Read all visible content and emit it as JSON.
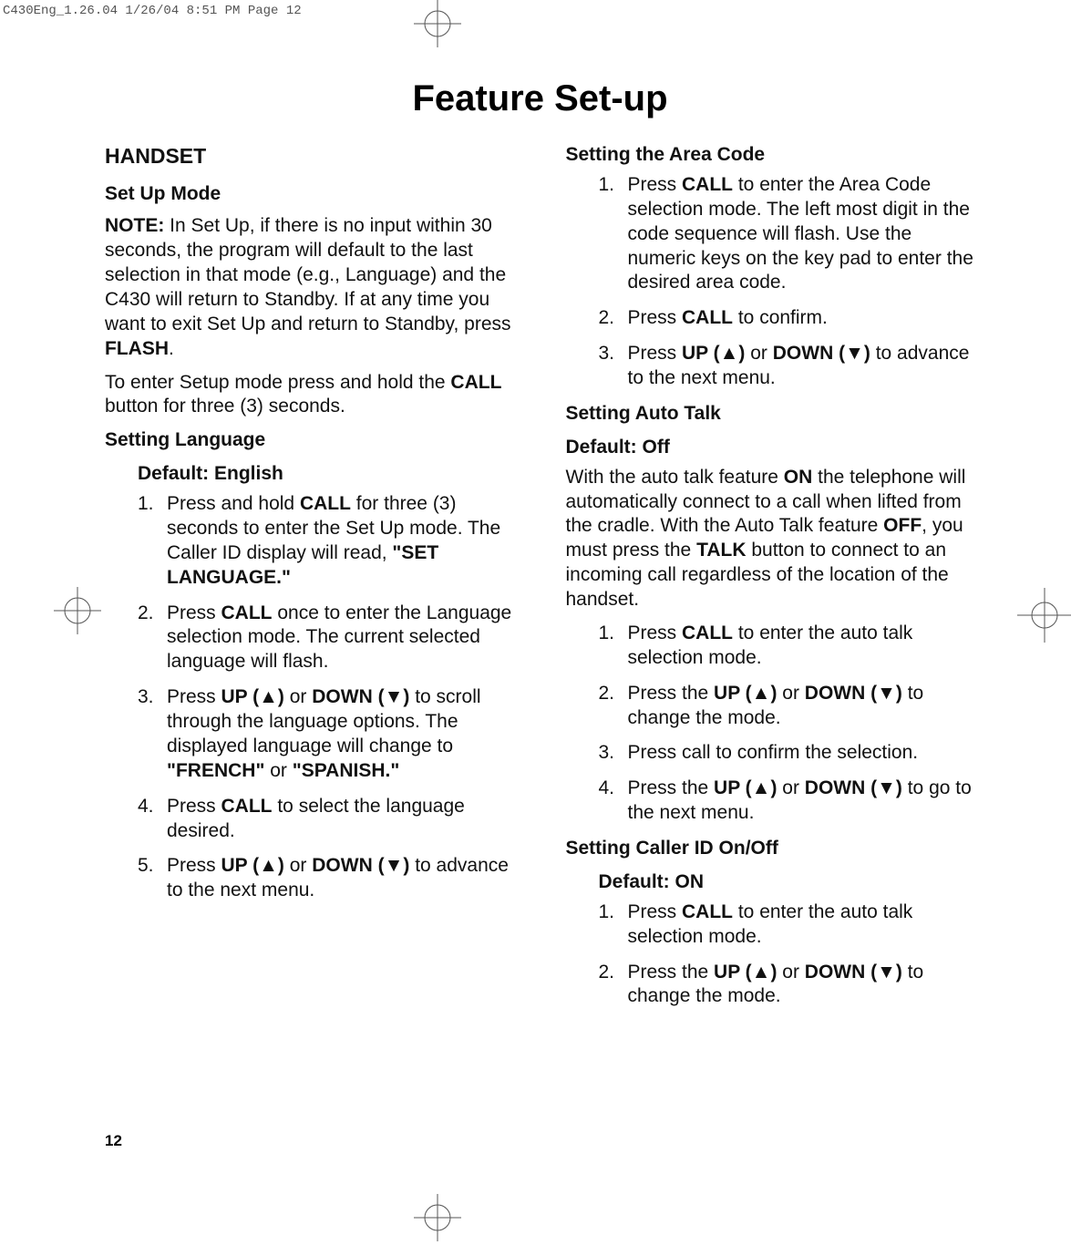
{
  "slug": "C430Eng_1.26.04  1/26/04  8:51 PM  Page 12",
  "page_number": "12",
  "title": "Feature Set-up",
  "left": {
    "heading_main": "HANDSET",
    "section1_title": "Set Up Mode",
    "section1_body_html": "<b>NOTE:</b>  In Set Up, if there is no input within 30 seconds, the program will default to the last selection in that mode (e.g., Language) and the C430 will return to Standby. If at any time you want to exit Set Up and return to Standby, press <b>FLASH</b>.",
    "section1_body2_html": "To enter Setup mode press and hold the <b>CALL</b> button for three (3) seconds.",
    "section2_title": "Setting Language",
    "section2_default": "Default: English",
    "section2_steps": [
      {
        "num": "1.",
        "txt_html": "Press and hold <b>CALL</b> for three (3) seconds to enter the Set Up mode. The Caller ID display will read, <b>\"SET LANGUAGE.\"</b>"
      },
      {
        "num": "2.",
        "txt_html": "Press <b>CALL</b> once to enter the Language selection mode. The current selected language will flash."
      },
      {
        "num": "3.",
        "txt_html": "Press <b>UP (▲)</b> or <b>DOWN (▼)</b> to scroll through the language options. The displayed language will change to <b>\"FRENCH\"</b> or <b>\"SPANISH.\"</b>"
      },
      {
        "num": "4.",
        "txt_html": "Press <b>CALL</b> to select the language desired."
      },
      {
        "num": "5.",
        "txt_html": "Press <b>UP (▲)</b> or <b>DOWN (▼)</b> to advance to the next menu."
      }
    ]
  },
  "right": {
    "section1_title": "Setting the Area Code",
    "section1_steps": [
      {
        "num": "1.",
        "txt_html": "Press <b>CALL</b> to enter the Area Code selection mode. The left most digit in the code sequence will flash. Use the numeric keys on the key pad to enter the desired area code."
      },
      {
        "num": "2.",
        "txt_html": "Press <b>CALL</b> to confirm."
      },
      {
        "num": "3.",
        "txt_html": "Press <b>UP (▲)</b> or <b>DOWN (▼)</b> to advance to the next menu."
      }
    ],
    "section2_title": "Setting Auto Talk",
    "section2_default": "Default: Off",
    "section2_body_html": "With the auto talk feature <b>ON</b> the telephone will automatically connect to a call when lifted from the cradle.  With the Auto Talk feature <b>OFF</b>, you must press the <b>TALK</b> button to connect to an incoming call regardless of the location of the handset.",
    "section2_steps": [
      {
        "num": "1.",
        "txt_html": "Press <b>CALL</b> to enter the auto talk selection mode."
      },
      {
        "num": "2.",
        "txt_html": "Press the <b>UP (▲)</b> or <b>DOWN (▼)</b> to change the mode."
      },
      {
        "num": "3.",
        "txt_html": "Press call to confirm the selection."
      },
      {
        "num": "4.",
        "txt_html": "Press the <b>UP (▲)</b> or <b>DOWN (▼)</b> to go to the next menu."
      }
    ],
    "section3_title": "Setting Caller ID On/Off",
    "section3_default": "Default: ON",
    "section3_steps": [
      {
        "num": "1.",
        "txt_html": "Press <b>CALL</b> to enter the auto talk selection mode."
      },
      {
        "num": "2.",
        "txt_html": "Press the <b>UP (▲)</b> or <b>DOWN (▼)</b> to change the mode."
      }
    ]
  }
}
